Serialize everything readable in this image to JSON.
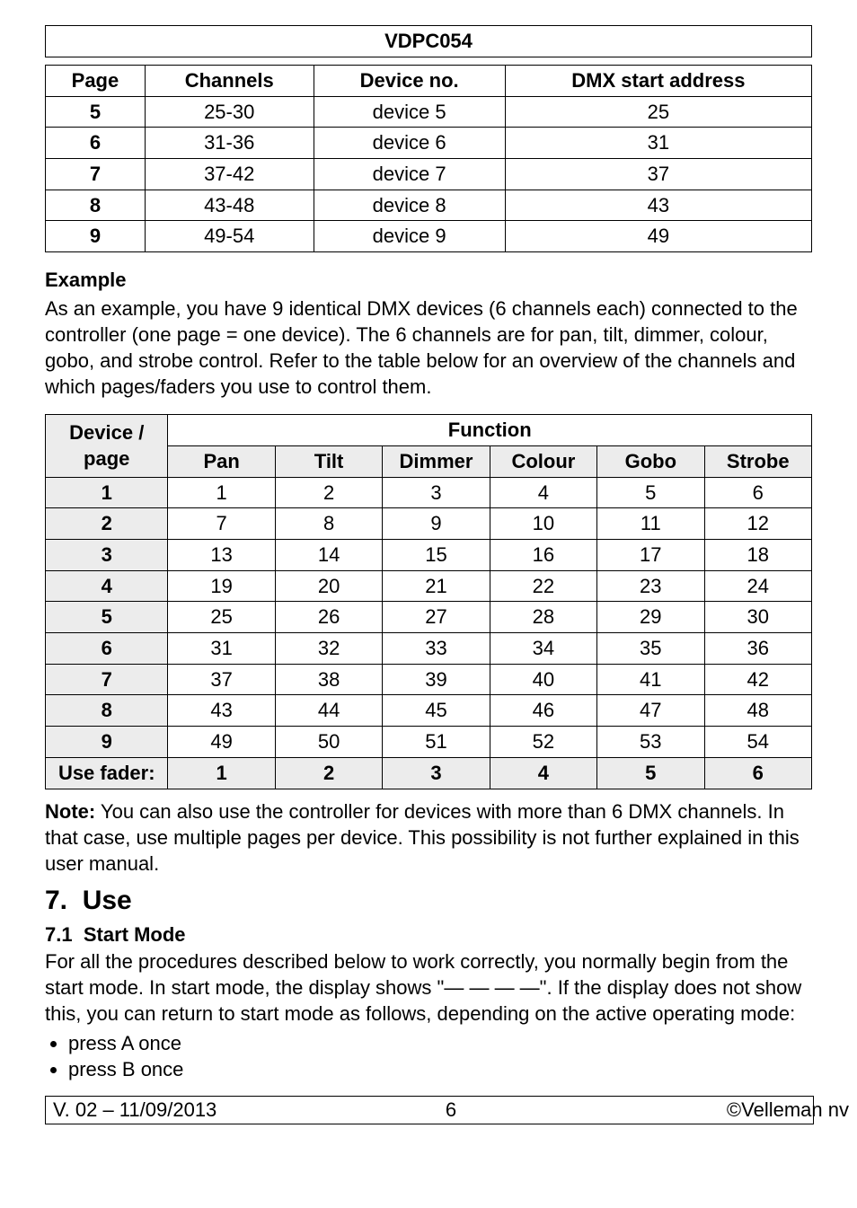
{
  "doc_code": "VDPC054",
  "table1": {
    "headers": [
      "Page",
      "Channels",
      "Device no.",
      "DMX start address"
    ],
    "rows": [
      {
        "page": "5",
        "channels": "25-30",
        "device": "device 5",
        "addr": "25"
      },
      {
        "page": "6",
        "channels": "31-36",
        "device": "device 6",
        "addr": "31"
      },
      {
        "page": "7",
        "channels": "37-42",
        "device": "device 7",
        "addr": "37"
      },
      {
        "page": "8",
        "channels": "43-48",
        "device": "device 8",
        "addr": "43"
      },
      {
        "page": "9",
        "channels": "49-54",
        "device": "device 9",
        "addr": "49"
      }
    ]
  },
  "example_heading": "Example",
  "example_text": "As an example, you have 9 identical DMX devices (6 channels each) connected to the controller (one page = one device). The 6 channels are for pan, tilt, dimmer, colour, gobo, and strobe control. Refer to the table below for an overview of the channels and which pages/faders you use to control them.",
  "table2": {
    "top_left": "Device / page",
    "top_right": "Function",
    "cols": [
      "Pan",
      "Tilt",
      "Dimmer",
      "Colour",
      "Gobo",
      "Strobe"
    ],
    "rows": [
      {
        "label": "1",
        "cells": [
          "1",
          "2",
          "3",
          "4",
          "5",
          "6"
        ]
      },
      {
        "label": "2",
        "cells": [
          "7",
          "8",
          "9",
          "10",
          "11",
          "12"
        ]
      },
      {
        "label": "3",
        "cells": [
          "13",
          "14",
          "15",
          "16",
          "17",
          "18"
        ]
      },
      {
        "label": "4",
        "cells": [
          "19",
          "20",
          "21",
          "22",
          "23",
          "24"
        ]
      },
      {
        "label": "5",
        "cells": [
          "25",
          "26",
          "27",
          "28",
          "29",
          "30"
        ]
      },
      {
        "label": "6",
        "cells": [
          "31",
          "32",
          "33",
          "34",
          "35",
          "36"
        ]
      },
      {
        "label": "7",
        "cells": [
          "37",
          "38",
          "39",
          "40",
          "41",
          "42"
        ]
      },
      {
        "label": "8",
        "cells": [
          "43",
          "44",
          "45",
          "46",
          "47",
          "48"
        ]
      },
      {
        "label": "9",
        "cells": [
          "49",
          "50",
          "51",
          "52",
          "53",
          "54"
        ]
      }
    ],
    "footer": {
      "label": "Use fader:",
      "cells": [
        "1",
        "2",
        "3",
        "4",
        "5",
        "6"
      ]
    }
  },
  "note_prefix": "Note:",
  "note_text": " You can also use the controller for devices with more than 6 DMX channels. In that case, use multiple pages per device. This possibility is not further explained in this user manual.",
  "section_number": "7.",
  "section_title": "Use",
  "sub_number": "7.1",
  "sub_title": "Start Mode",
  "sub_text": "For all the procedures described below to work correctly, you normally begin from the start mode. In start mode, the display shows \"— — — —\". If the display does not show this, you can return to start mode as follows, depending on the active operating mode:",
  "bullets": [
    "press A once",
    "press B once"
  ],
  "footer": {
    "left": "V. 02 – 11/09/2013",
    "center": "6",
    "right": "©Velleman nv"
  }
}
